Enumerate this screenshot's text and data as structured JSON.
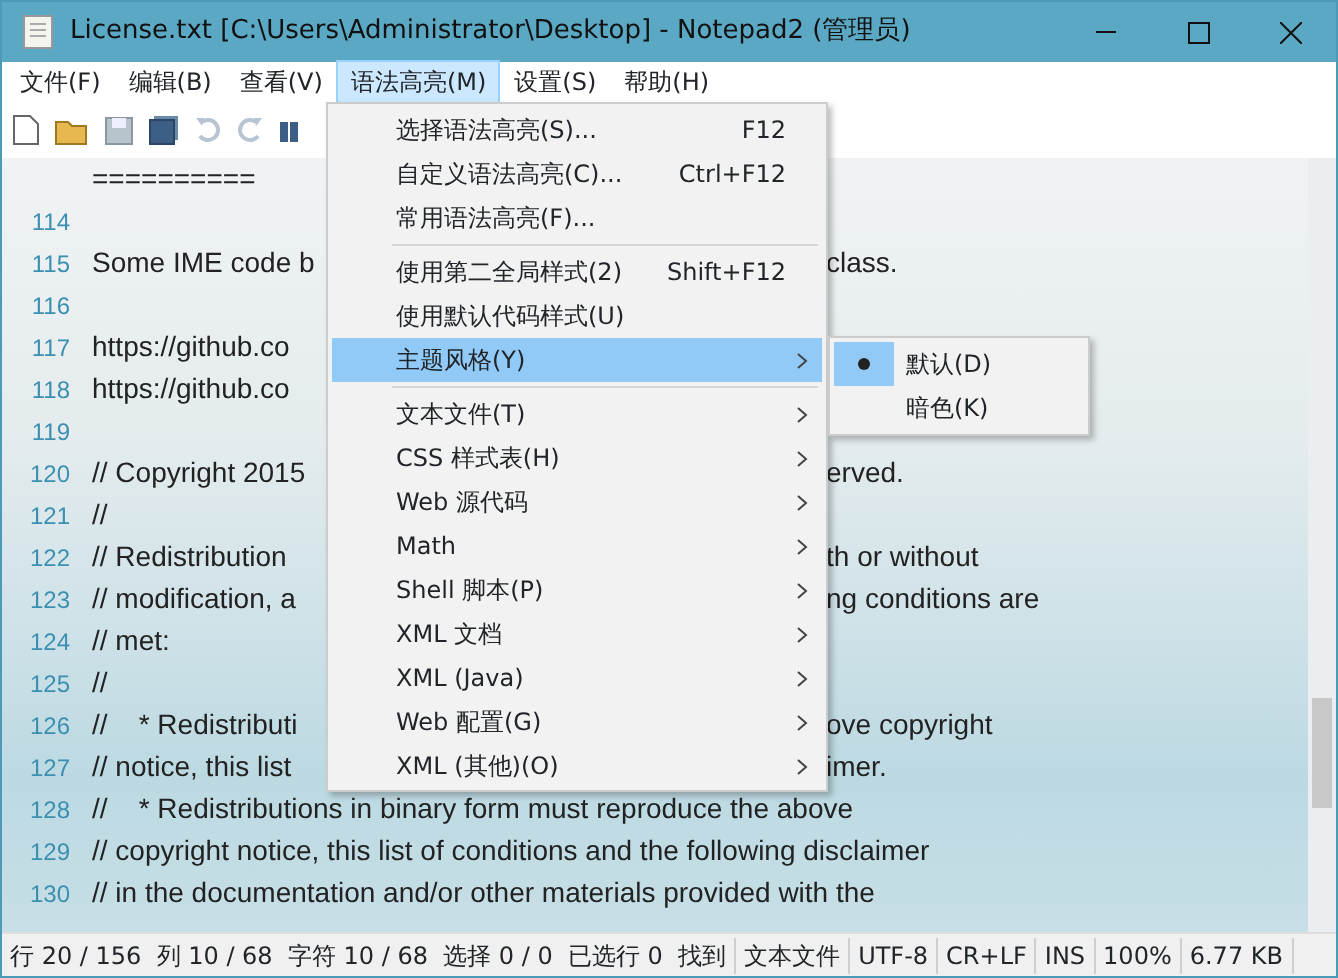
{
  "window": {
    "title": "License.txt [C:\\Users\\Administrator\\Desktop] - Notepad2 (管理员)"
  },
  "menu_bar": [
    {
      "label": "文件(F)",
      "selected": false
    },
    {
      "label": "编辑(B)",
      "selected": false
    },
    {
      "label": "查看(V)",
      "selected": false
    },
    {
      "label": "语法高亮(M)",
      "selected": true
    },
    {
      "label": "设置(S)",
      "selected": false
    },
    {
      "label": "帮助(H)",
      "selected": false
    }
  ],
  "editor_lines": [
    {
      "text": "=========="
    },
    {
      "number": "114"
    },
    {
      "number": "115",
      "text": "Some IME code b",
      "tail": "class."
    },
    {
      "number": "116"
    },
    {
      "number": "117",
      "text": "https://github.co"
    },
    {
      "number": "118",
      "text": "https://github.co"
    },
    {
      "number": "119"
    },
    {
      "number": "120",
      "text": "// Copyright 2015",
      "tail": "erved."
    },
    {
      "number": "121",
      "text": "//"
    },
    {
      "number": "122",
      "text": "// Redistribution",
      "tail": "th or without"
    },
    {
      "number": "123",
      "text": "// modification, a",
      "tail": "ng conditions are"
    },
    {
      "number": "124",
      "text": "// met:"
    },
    {
      "number": "125",
      "text": "//"
    },
    {
      "number": "126",
      "text": "//    * Redistributi",
      "tail": "ove copyright"
    },
    {
      "number": "127",
      "text": "// notice, this list",
      "tail": "imer."
    },
    {
      "number": "128",
      "text": "//    * Redistributions in binary form must reproduce the above"
    },
    {
      "number": "129",
      "text": "// copyright notice, this list of conditions and the following disclaimer"
    },
    {
      "number": "130",
      "text": "// in the documentation and/or other materials provided with the"
    }
  ],
  "dropdown_menu": [
    {
      "kind": "item",
      "label": "选择语法高亮(S)...",
      "shortcut": "F12",
      "submenu": false,
      "selected": false
    },
    {
      "kind": "item",
      "label": "自定义语法高亮(C)...",
      "shortcut": "Ctrl+F12",
      "submenu": false,
      "selected": false
    },
    {
      "kind": "item",
      "label": "常用语法高亮(F)...",
      "submenu": false,
      "selected": false
    },
    {
      "kind": "separator"
    },
    {
      "kind": "item",
      "label": "使用第二全局样式(2)",
      "shortcut": "Shift+F12",
      "submenu": false,
      "selected": false
    },
    {
      "kind": "item",
      "label": "使用默认代码样式(U)",
      "submenu": false,
      "selected": false
    },
    {
      "kind": "item",
      "label": "主题风格(Y)",
      "submenu": true,
      "selected": true
    },
    {
      "kind": "separator"
    },
    {
      "kind": "item",
      "label": "文本文件(T)",
      "submenu": true,
      "selected": false
    },
    {
      "kind": "item",
      "label": "CSS 样式表(H)",
      "submenu": true,
      "selected": false
    },
    {
      "kind": "item",
      "label": "Web 源代码",
      "submenu": true,
      "selected": false
    },
    {
      "kind": "item",
      "label": "Math",
      "submenu": true,
      "selected": false
    },
    {
      "kind": "item",
      "label": "Shell 脚本(P)",
      "submenu": true,
      "selected": false
    },
    {
      "kind": "item",
      "label": "XML 文档",
      "submenu": true,
      "selected": false
    },
    {
      "kind": "item",
      "label": "XML (Java)",
      "submenu": true,
      "selected": false
    },
    {
      "kind": "item",
      "label": "Web 配置(G)",
      "submenu": true,
      "selected": false
    },
    {
      "kind": "item",
      "label": "XML (其他)(O)",
      "submenu": true,
      "selected": false
    }
  ],
  "submenu": [
    {
      "label": "默认(D)",
      "checked": true
    },
    {
      "label": "暗色(K)",
      "checked": false
    }
  ],
  "status_bar": [
    "行 20 / 156  列 10 / 68  字符 10 / 68  选择 0 / 0  已选行 0  找到",
    "文本文件",
    "UTF-8",
    "CR+LF",
    "INS",
    "100%",
    "6.77 KB"
  ]
}
